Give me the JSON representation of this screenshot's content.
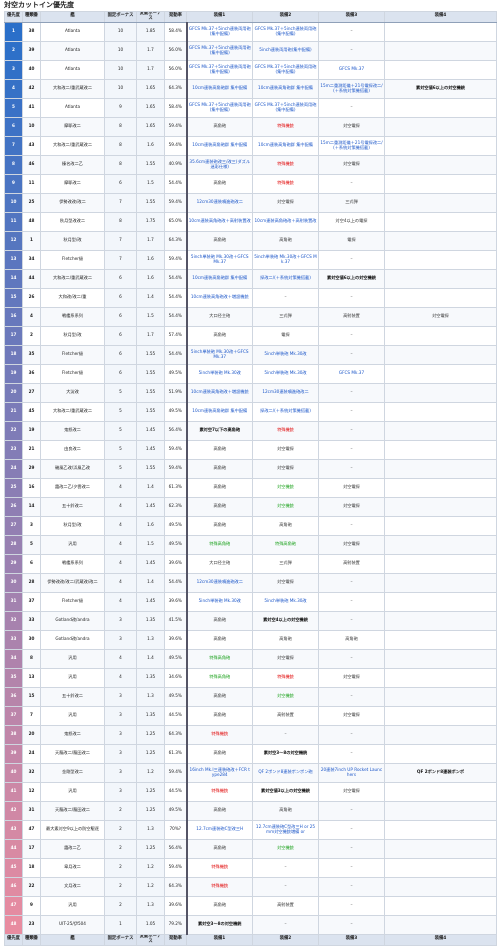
{
  "title": "対空カットイン優先度",
  "headers": [
    "優先度",
    "種類番",
    "艦",
    "固定ボーナス",
    "変動ボーナス",
    "発動率",
    "装備1",
    "装備2",
    "装備3",
    "装備4"
  ],
  "footer": [
    "優先度",
    "種類番",
    "艦",
    "固定ボーナス",
    "変動ボーナス",
    "発動率",
    "装備1",
    "装備2",
    "装備3",
    "装備4"
  ],
  "colors": {
    "rank_blue": "#2a6fc9",
    "rank_pink": "#e8a7b3",
    "header_bg": "#dbe3ef"
  },
  "rows": [
    {
      "rank": "1",
      "no": "38",
      "ship": "Atlanta",
      "fixed": "10",
      "var": "1.85",
      "rate": "58.4%",
      "e1": "GFCS Mk.37＋5inch連装両用砲(集中配備)",
      "c1": "blue",
      "e2": "GFCS Mk.37＋5inch連装両用砲(集中配備)",
      "c2": "blue",
      "e3": "–",
      "c3": "dash",
      "e4": "",
      "c4": "dash"
    },
    {
      "rank": "2",
      "no": "39",
      "ship": "Atlanta",
      "fixed": "10",
      "var": "1.7",
      "rate": "56.0%",
      "e1": "GFCS Mk.37＋5inch連装両用砲(集中配備)",
      "c1": "blue",
      "e2": "5inch連装両用砲(集中配備)",
      "c2": "blue",
      "e3": "–",
      "c3": "dash",
      "e4": "",
      "c4": "dash"
    },
    {
      "rank": "3",
      "no": "40",
      "ship": "Atlanta",
      "fixed": "10",
      "var": "1.7",
      "rate": "56.0%",
      "e1": "GFCS Mk.37＋5inch連装両用砲(集中配備)",
      "c1": "blue",
      "e2": "GFCS Mk.37＋5inch連装両用砲(集中配備)",
      "c2": "blue",
      "e3": "GFCS Mk.37",
      "c3": "blue",
      "e4": "",
      "c4": "dash"
    },
    {
      "rank": "4",
      "no": "42",
      "ship": "大和改二/重武蔵改二",
      "fixed": "10",
      "var": "1.65",
      "rate": "64.3%",
      "e1": "10cm連装高角砲群 集中配備",
      "c1": "blue",
      "e2": "10cm連装高角砲群 集中配備",
      "c2": "blue",
      "e3": "15m二重測距儀＋21号電探改二/(＋系統対策機搭載)",
      "c3": "blue",
      "e4": "素対空値6以上の対空機銃",
      "c4": "dark"
    },
    {
      "rank": "5",
      "no": "41",
      "ship": "Atlanta",
      "fixed": "9",
      "var": "1.65",
      "rate": "58.4%",
      "e1": "GFCS Mk.37＋5inch連装両用砲(集中配備)",
      "c1": "blue",
      "e2": "GFCS Mk.37＋5inch連装両用砲(集中配備)",
      "c2": "blue",
      "e3": "–",
      "c3": "dash",
      "e4": "",
      "c4": "dash"
    },
    {
      "rank": "6",
      "no": "10",
      "ship": "摩耶改二",
      "fixed": "8",
      "var": "1.65",
      "rate": "59.4%",
      "e1": "高角砲",
      "c1": "gray",
      "e2": "特殊機銃",
      "c2": "red",
      "e3": "対空電探",
      "c3": "gray",
      "e4": "",
      "c4": "dash"
    },
    {
      "rank": "7",
      "no": "43",
      "ship": "大和改二/重武蔵改二",
      "fixed": "8",
      "var": "1.6",
      "rate": "59.4%",
      "e1": "10cm連装高角砲群 集中配備",
      "c1": "blue",
      "e2": "10cm連装高角砲群 集中配備",
      "c2": "blue",
      "e3": "15m二重測距儀＋21号電探改二/(＋系統対策機搭載)",
      "c3": "blue",
      "e4": "",
      "c4": "dash"
    },
    {
      "rank": "8",
      "no": "46",
      "ship": "榛名改二乙",
      "fixed": "8",
      "var": "1.55",
      "rate": "40.9%",
      "e1": "35.6cm連装砲改三/改三(ダズル迷彩仕様)",
      "c1": "blue",
      "e2": "特殊機銃",
      "c2": "red",
      "e3": "対空電探",
      "c3": "gray",
      "e4": "",
      "c4": "dash"
    },
    {
      "rank": "9",
      "no": "11",
      "ship": "摩耶改二",
      "fixed": "6",
      "var": "1.5",
      "rate": "54.4%",
      "e1": "高角砲",
      "c1": "gray",
      "e2": "特殊機銃",
      "c2": "red",
      "e3": "–",
      "c3": "dash",
      "e4": "",
      "c4": "dash"
    },
    {
      "rank": "10",
      "no": "25",
      "ship": "伊勢改改/改二",
      "fixed": "7",
      "var": "1.55",
      "rate": "59.4%",
      "e1": "12cm30連装噴進砲改二",
      "c1": "blue",
      "e2": "対空電探",
      "c2": "gray",
      "e3": "三式弾",
      "c3": "gray",
      "e4": "",
      "c4": "dash"
    },
    {
      "rank": "11",
      "no": "48",
      "ship": "秋月型改改二",
      "fixed": "8",
      "var": "1.75",
      "rate": "65.0%",
      "e1": "10cm連装高角砲改＋高射装置改",
      "c1": "blue",
      "e2": "10cm連装高角砲改＋高射装置改",
      "c2": "blue",
      "e3": "対空4以上の電探",
      "c3": "gray",
      "e4": "",
      "c4": "dash"
    },
    {
      "rank": "12",
      "no": "1",
      "ship": "秋月型/改",
      "fixed": "7",
      "var": "1.7",
      "rate": "64.3%",
      "e1": "高角砲",
      "c1": "gray",
      "e2": "高角砲",
      "c2": "gray",
      "e3": "電探",
      "c3": "gray",
      "e4": "",
      "c4": "dash"
    },
    {
      "rank": "13",
      "no": "34",
      "ship": "Fletcher級",
      "fixed": "7",
      "var": "1.6",
      "rate": "59.4%",
      "e1": "5inch単装砲 Mk.30改＋GFCS Mk.37",
      "c1": "blue",
      "e2": "5inch単装砲 Mk.30改＋GFCS Mk.37",
      "c2": "blue",
      "e3": "–",
      "c3": "dash",
      "e4": "",
      "c4": "dash"
    },
    {
      "rank": "14",
      "no": "44",
      "ship": "大和改二/重武蔵改二",
      "fixed": "6",
      "var": "1.6",
      "rate": "54.4%",
      "e1": "10cm連装高角砲群 集中配備",
      "c1": "blue",
      "e2": "探改二/(＋系統対策機搭載)",
      "c2": "blue",
      "e3": "素対空値6以上の対空機銃",
      "c3": "dark",
      "e4": "",
      "c4": "dash"
    },
    {
      "rank": "15",
      "no": "26",
      "ship": "大和改/改二/重",
      "fixed": "6",
      "var": "1.4",
      "rate": "54.4%",
      "e1": "10cm連装高角砲改＋増設機銃",
      "c1": "blue",
      "e2": "–",
      "c2": "dash",
      "e3": "–",
      "c3": "dash",
      "e4": "",
      "c4": "dash"
    },
    {
      "rank": "16",
      "no": "4",
      "ship": "戦艦系系列",
      "fixed": "6",
      "var": "1.5",
      "rate": "54.4%",
      "e1": "大口径主砲",
      "c1": "gray",
      "e2": "三式弾",
      "c2": "gray",
      "e3": "高射装置",
      "c3": "gray",
      "e4": "対空電探",
      "c4": "gray"
    },
    {
      "rank": "17",
      "no": "2",
      "ship": "秋月型/改",
      "fixed": "6",
      "var": "1.7",
      "rate": "57.4%",
      "e1": "高角砲",
      "c1": "gray",
      "e2": "電探",
      "c2": "gray",
      "e3": "–",
      "c3": "dash",
      "e4": "",
      "c4": "dash"
    },
    {
      "rank": "18",
      "no": "35",
      "ship": "Fletcher級",
      "fixed": "6",
      "var": "1.55",
      "rate": "54.4%",
      "e1": "5inch単装砲 Mk.30改＋GFCS Mk.37",
      "c1": "blue",
      "e2": "5inch単装砲 Mk.30改",
      "c2": "blue",
      "e3": "–",
      "c3": "dash",
      "e4": "",
      "c4": "dash"
    },
    {
      "rank": "19",
      "no": "36",
      "ship": "Fletcher級",
      "fixed": "6",
      "var": "1.55",
      "rate": "49.5%",
      "e1": "5inch単装砲 Mk.30改",
      "c1": "blue",
      "e2": "5inch単装砲 Mk.30改",
      "c2": "blue",
      "e3": "GFCS Mk.37",
      "c3": "blue",
      "e4": "",
      "c4": "dash"
    },
    {
      "rank": "20",
      "no": "27",
      "ship": "大淀改",
      "fixed": "5",
      "var": "1.55",
      "rate": "51.9%",
      "e1": "10cm連装高角砲改＋増設機銃",
      "c1": "blue",
      "e2": "12cm30連装噴進砲改二",
      "c2": "blue",
      "e3": "–",
      "c3": "dash",
      "e4": "",
      "c4": "dash"
    },
    {
      "rank": "21",
      "no": "45",
      "ship": "大和改二/重武蔵改二",
      "fixed": "5",
      "var": "1.55",
      "rate": "49.5%",
      "e1": "10cm連装高角砲群 集中配備",
      "c1": "blue",
      "e2": "探改二/(＋系統対策機搭載)",
      "c2": "blue",
      "e3": "–",
      "c3": "dash",
      "e4": "",
      "c4": "dash"
    },
    {
      "rank": "22",
      "no": "19",
      "ship": "鬼怒改二",
      "fixed": "5",
      "var": "1.45",
      "rate": "56.4%",
      "e1": "素対空7以下の高角砲",
      "c1": "dark",
      "e2": "特殊機銃",
      "c2": "red",
      "e3": "–",
      "c3": "dash",
      "e4": "",
      "c4": "dash"
    },
    {
      "rank": "23",
      "no": "21",
      "ship": "由良改二",
      "fixed": "5",
      "var": "1.45",
      "rate": "59.4%",
      "e1": "高角砲",
      "c1": "gray",
      "e2": "対空電探",
      "c2": "gray",
      "e3": "–",
      "c3": "dash",
      "e4": "",
      "c4": "dash"
    },
    {
      "rank": "24",
      "no": "29",
      "ship": "磯風乙改/浜風乙改",
      "fixed": "5",
      "var": "1.55",
      "rate": "59.4%",
      "e1": "高角砲",
      "c1": "gray",
      "e2": "対空電探",
      "c2": "gray",
      "e3": "–",
      "c3": "dash",
      "e4": "",
      "c4": "dash"
    },
    {
      "rank": "25",
      "no": "16",
      "ship": "霞改二乙/夕雲改二",
      "fixed": "4",
      "var": "1.4",
      "rate": "61.3%",
      "e1": "高角砲",
      "c1": "gray",
      "e2": "対空機銃",
      "c2": "green",
      "e3": "対空電探",
      "c3": "gray",
      "e4": "",
      "c4": "dash"
    },
    {
      "rank": "26",
      "no": "14",
      "ship": "五十鈴改二",
      "fixed": "4",
      "var": "1.45",
      "rate": "62.3%",
      "e1": "高角砲",
      "c1": "gray",
      "e2": "対空機銃",
      "c2": "green",
      "e3": "対空電探",
      "c3": "gray",
      "e4": "",
      "c4": "dash"
    },
    {
      "rank": "27",
      "no": "3",
      "ship": "秋月型/改",
      "fixed": "4",
      "var": "1.6",
      "rate": "49.5%",
      "e1": "高角砲",
      "c1": "gray",
      "e2": "高角砲",
      "c2": "gray",
      "e3": "–",
      "c3": "dash",
      "e4": "",
      "c4": "dash"
    },
    {
      "rank": "28",
      "no": "5",
      "ship": "汎用",
      "fixed": "4",
      "var": "1.5",
      "rate": "49.5%",
      "e1": "特殊高角砲",
      "c1": "green",
      "e2": "特殊高角砲",
      "c2": "green",
      "e3": "対空電探",
      "c3": "gray",
      "e4": "",
      "c4": "dash"
    },
    {
      "rank": "29",
      "no": "6",
      "ship": "戦艦系系列",
      "fixed": "4",
      "var": "1.45",
      "rate": "39.6%",
      "e1": "大口径主砲",
      "c1": "gray",
      "e2": "三式弾",
      "c2": "gray",
      "e3": "高射装置",
      "c3": "gray",
      "e4": "",
      "c4": "dash"
    },
    {
      "rank": "30",
      "no": "28",
      "ship": "伊勢改改/改二/武蔵改/改二",
      "fixed": "4",
      "var": "1.4",
      "rate": "54.4%",
      "e1": "12cm30連装噴進砲改二",
      "c1": "blue",
      "e2": "対空電探",
      "c2": "gray",
      "e3": "–",
      "c3": "dash",
      "e4": "",
      "c4": "dash"
    },
    {
      "rank": "31",
      "no": "37",
      "ship": "Fletcher級",
      "fixed": "4",
      "var": "1.45",
      "rate": "39.6%",
      "e1": "5inch単装砲 Mk.30改",
      "c1": "blue",
      "e2": "5inch単装砲 Mk.30改",
      "c2": "blue",
      "e3": "–",
      "c3": "dash",
      "e4": "",
      "c4": "dash"
    },
    {
      "rank": "32",
      "no": "33",
      "ship": "Gotland改/andra",
      "fixed": "3",
      "var": "1.35",
      "rate": "41.5%",
      "e1": "高角砲",
      "c1": "gray",
      "e2": "素対空4以上の対空機銃",
      "c2": "dark",
      "e3": "–",
      "c3": "dash",
      "e4": "",
      "c4": "dash"
    },
    {
      "rank": "33",
      "no": "30",
      "ship": "Gotland改/andra",
      "fixed": "3",
      "var": "1.3",
      "rate": "39.6%",
      "e1": "高角砲",
      "c1": "gray",
      "e2": "高角砲",
      "c2": "gray",
      "e3": "高角砲",
      "c3": "gray",
      "e4": "",
      "c4": "dash"
    },
    {
      "rank": "34",
      "no": "8",
      "ship": "汎用",
      "fixed": "4",
      "var": "1.4",
      "rate": "49.5%",
      "e1": "特殊高角砲",
      "c1": "green",
      "e2": "対空電探",
      "c2": "gray",
      "e3": "–",
      "c3": "dash",
      "e4": "",
      "c4": "dash"
    },
    {
      "rank": "35",
      "no": "13",
      "ship": "汎用",
      "fixed": "4",
      "var": "1.35",
      "rate": "34.6%",
      "e1": "特殊高角砲",
      "c1": "green",
      "e2": "特殊機銃",
      "c2": "red",
      "e3": "対空電探",
      "c3": "gray",
      "e4": "",
      "c4": "dash"
    },
    {
      "rank": "36",
      "no": "15",
      "ship": "五十鈴改二",
      "fixed": "3",
      "var": "1.3",
      "rate": "49.5%",
      "e1": "高角砲",
      "c1": "gray",
      "e2": "対空機銃",
      "c2": "green",
      "e3": "–",
      "c3": "dash",
      "e4": "",
      "c4": "dash"
    },
    {
      "rank": "37",
      "no": "7",
      "ship": "汎用",
      "fixed": "3",
      "var": "1.35",
      "rate": "44.5%",
      "e1": "高角砲",
      "c1": "gray",
      "e2": "高射装置",
      "c2": "gray",
      "e3": "対空電探",
      "c3": "gray",
      "e4": "",
      "c4": "dash"
    },
    {
      "rank": "38",
      "no": "20",
      "ship": "鬼怒改二",
      "fixed": "3",
      "var": "1.25",
      "rate": "64.3%",
      "e1": "特殊機銃",
      "c1": "red",
      "e2": "–",
      "c2": "dash",
      "e3": "–",
      "c3": "dash",
      "e4": "",
      "c4": "dash"
    },
    {
      "rank": "39",
      "no": "24",
      "ship": "天龍改二/龍田改二",
      "fixed": "3",
      "var": "1.25",
      "rate": "61.3%",
      "e1": "高角砲",
      "c1": "gray",
      "e2": "素対空3～8の対空機銃",
      "c2": "dark",
      "e3": "–",
      "c3": "dash",
      "e4": "",
      "c4": "dash"
    },
    {
      "rank": "40",
      "no": "32",
      "ship": "金剛型改二",
      "fixed": "3",
      "var": "1.2",
      "rate": "59.4%",
      "e1": "16inch Mk.I三連装砲改＋FCR type284",
      "c1": "blue",
      "e2": "QF 2ポンド8連装ポンポン砲",
      "c2": "blue",
      "e3": "20連装7inch UP Rocket Launchers",
      "c3": "blue",
      "e4": "QF 2ポンド8連装ポンポ",
      "c4": "dark"
    },
    {
      "rank": "41",
      "no": "12",
      "ship": "汎用",
      "fixed": "3",
      "var": "1.25",
      "rate": "44.5%",
      "e1": "特殊機銃",
      "c1": "red",
      "e2": "素対空値3以上の対空機銃",
      "c2": "dark",
      "e3": "対空電探",
      "c3": "gray",
      "e4": "",
      "c4": "dash"
    },
    {
      "rank": "42",
      "no": "31",
      "ship": "天龍改二/龍田改二",
      "fixed": "2",
      "var": "1.25",
      "rate": "49.5%",
      "e1": "高角砲",
      "c1": "gray",
      "e2": "高角砲",
      "c2": "gray",
      "e3": "–",
      "c3": "dash",
      "e4": "",
      "c4": "dash"
    },
    {
      "rank": "43",
      "no": "47",
      "ship": "最大素対空9以上の防空駆逐",
      "fixed": "2",
      "var": "1.3",
      "rate": "70%?",
      "e1": "12.7cm連装砲C型改三H",
      "c1": "blue",
      "e2": "12.7cm連装砲C型改三H or 25mm対空機銃増備 or",
      "c2": "blue",
      "e3": "–",
      "c3": "dash",
      "e4": "",
      "c4": "dash"
    },
    {
      "rank": "44",
      "no": "17",
      "ship": "霞改二乙",
      "fixed": "2",
      "var": "1.25",
      "rate": "56.4%",
      "e1": "高角砲",
      "c1": "gray",
      "e2": "対空機銃",
      "c2": "green",
      "e3": "–",
      "c3": "dash",
      "e4": "",
      "c4": "dash"
    },
    {
      "rank": "45",
      "no": "18",
      "ship": "皐月改二",
      "fixed": "2",
      "var": "1.2",
      "rate": "59.4%",
      "e1": "特殊機銃",
      "c1": "red",
      "e2": "–",
      "c2": "dash",
      "e3": "–",
      "c3": "dash",
      "e4": "",
      "c4": "dash"
    },
    {
      "rank": "46",
      "no": "22",
      "ship": "文月改二",
      "fixed": "2",
      "var": "1.2",
      "rate": "64.3%",
      "e1": "特殊機銃",
      "c1": "red",
      "e2": "–",
      "c2": "dash",
      "e3": "–",
      "c3": "dash",
      "e4": "",
      "c4": "dash"
    },
    {
      "rank": "47",
      "no": "9",
      "ship": "汎用",
      "fixed": "2",
      "var": "1.3",
      "rate": "39.6%",
      "e1": "高角砲",
      "c1": "gray",
      "e2": "高射装置",
      "c2": "gray",
      "e3": "–",
      "c3": "dash",
      "e4": "",
      "c4": "dash"
    },
    {
      "rank": "48",
      "no": "23",
      "ship": "UIT-25/伊504",
      "fixed": "1",
      "var": "1.05",
      "rate": "79.2%",
      "e1": "素対空3～8の対空機銃",
      "c1": "dark",
      "e2": "–",
      "c2": "dash",
      "e3": "–",
      "c3": "dash",
      "e4": "",
      "c4": "dash"
    }
  ]
}
